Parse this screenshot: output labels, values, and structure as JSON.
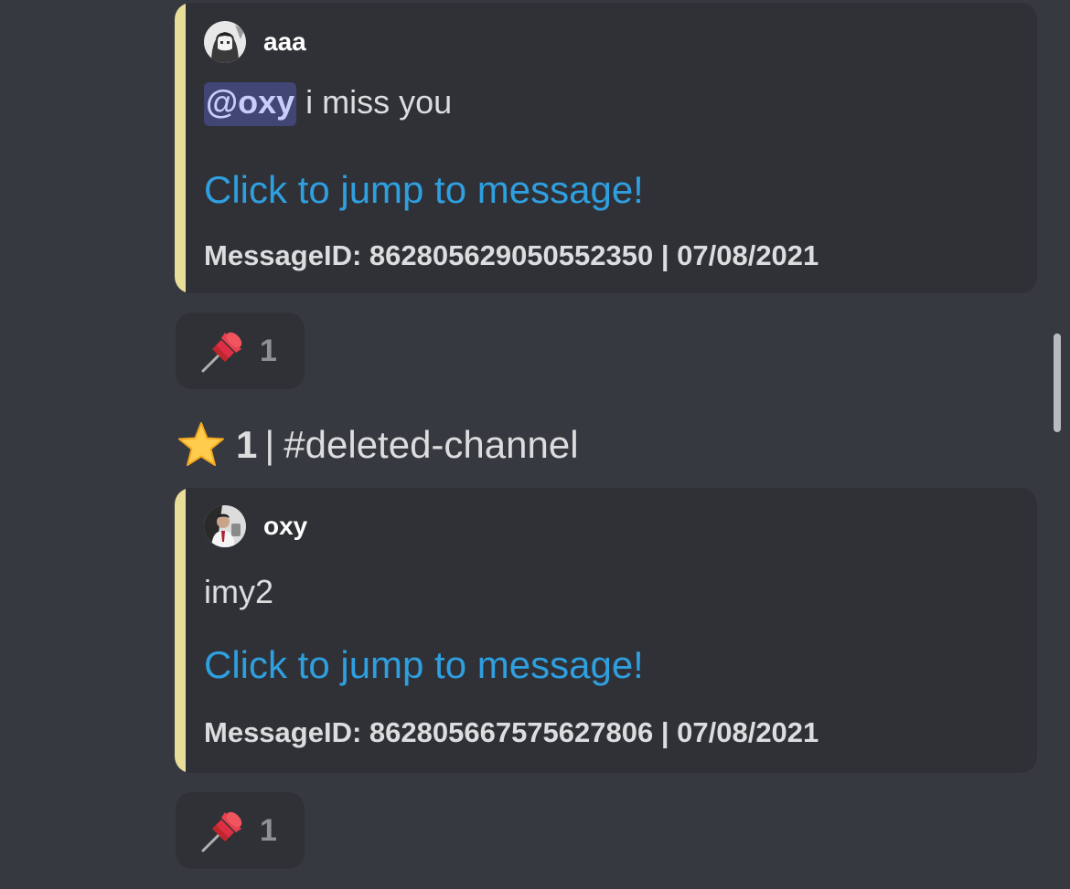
{
  "messages": [
    {
      "author": "aaa",
      "avatar_icon": "anime-avatar-icon",
      "mention": "@oxy",
      "text": " i miss you",
      "jump_link": "Click to jump to message!",
      "footer": "MessageID: 862805629050552350 | 07/08/2021",
      "reaction_icon": "pushpin-icon",
      "reaction_count": "1"
    },
    {
      "author": "oxy",
      "avatar_icon": "photo-avatar-icon",
      "text": "imy2",
      "jump_link": "Click to jump to message!",
      "footer": "MessageID: 862805667575627806 | 07/08/2021",
      "reaction_icon": "pushpin-icon",
      "reaction_count": "1"
    }
  ],
  "star_header": {
    "icon": "star-icon",
    "count": "1",
    "separator": "|",
    "channel": "#deleted-channel"
  },
  "colors": {
    "background": "#36393f",
    "embed_background": "#2f3136",
    "embed_accent": "#e9dd9a",
    "link": "#2f9fe0",
    "mention_bg": "#414675"
  }
}
